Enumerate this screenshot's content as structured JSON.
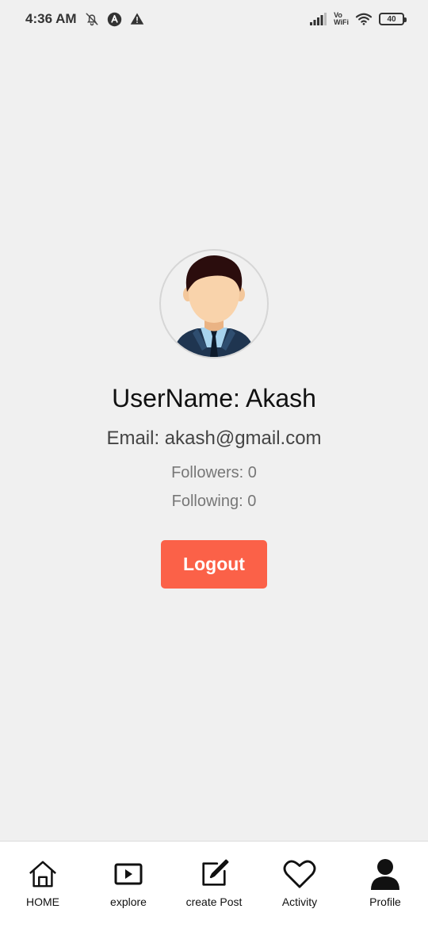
{
  "status_bar": {
    "time": "4:36 AM",
    "left_icons": [
      "bell-off-icon",
      "app-a-icon",
      "warning-icon"
    ],
    "vowifi_top": "Vo",
    "vowifi_bottom": "WiFi",
    "battery": "40"
  },
  "profile": {
    "username": "UserName: Akash",
    "email": "Email: akash@gmail.com",
    "followers": "Followers: 0",
    "following": "Following: 0",
    "logout_label": "Logout"
  },
  "colors": {
    "background": "#f0f0f0",
    "logout_button": "#fb6148",
    "nav_background": "#ffffff"
  },
  "bottom_nav": {
    "items": [
      {
        "label": "HOME",
        "icon": "home-icon"
      },
      {
        "label": "explore",
        "icon": "play-icon"
      },
      {
        "label": "create Post",
        "icon": "edit-icon"
      },
      {
        "label": "Activity",
        "icon": "heart-icon"
      },
      {
        "label": "Profile",
        "icon": "user-icon"
      }
    ]
  }
}
